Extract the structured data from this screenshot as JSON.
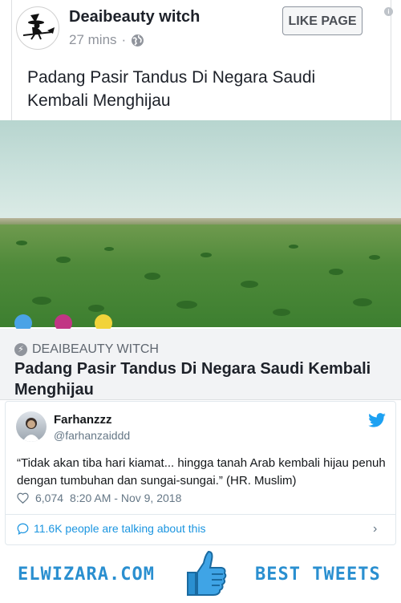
{
  "post": {
    "page_name": "Deaibeauty witch",
    "time": "27 mins",
    "audience_icon": "globe-icon",
    "like_button": "LIKE PAGE",
    "text": "Padang Pasir Tandus Di Negara Saudi Kembali Menghijau"
  },
  "link_preview": {
    "domain": "DEAIBEAUTY WITCH",
    "title": "Padang Pasir Tandus Di Negara Saudi Kembali Menghijau"
  },
  "tweet": {
    "name": "Farhanzzz",
    "handle": "@farhanzaiddd",
    "text": "“Tidak akan tiba hari kiamat... hingga tanah Arab kembali hijau penuh dengan tumbuhan dan sungai-sungai.” (HR. Muslim)",
    "likes": "6,074",
    "timestamp": "8:20 AM - Nov 9, 2018",
    "talking": "11.6K people are talking about this"
  },
  "footer": {
    "brand": "ELWIZARA.COM",
    "tag": "BEST TWEETS"
  },
  "colors": {
    "twitter_blue": "#1da1f2",
    "footer_blue": "#2a8fd0",
    "fb_gray": "#90949c"
  }
}
